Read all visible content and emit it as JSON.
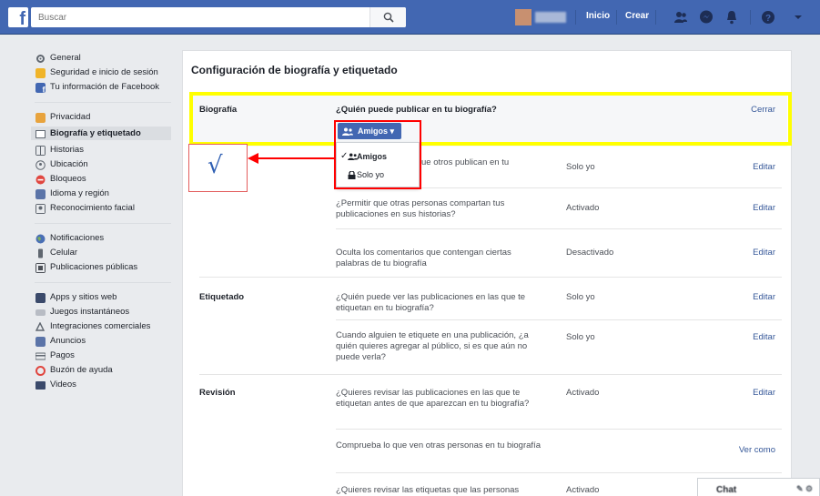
{
  "topbar": {
    "search_placeholder": "Buscar",
    "nav_inicio": "Inicio",
    "nav_crear": "Crear"
  },
  "sidebar": {
    "groups": [
      [
        {
          "label": "General",
          "icon": "gear-icon"
        },
        {
          "label": "Seguridad e inicio de sesión",
          "icon": "shield-icon"
        },
        {
          "label": "Tu información de Facebook",
          "icon": "facebook-icon"
        }
      ],
      [
        {
          "label": "Privacidad",
          "icon": "lock-icon"
        },
        {
          "label": "Biografía y etiquetado",
          "icon": "timeline-icon",
          "active": true
        },
        {
          "label": "Historias",
          "icon": "book-icon"
        },
        {
          "label": "Ubicación",
          "icon": "location-icon"
        },
        {
          "label": "Bloqueos",
          "icon": "block-icon"
        },
        {
          "label": "Idioma y región",
          "icon": "language-icon"
        },
        {
          "label": "Reconocimiento facial",
          "icon": "face-icon"
        }
      ],
      [
        {
          "label": "Notificaciones",
          "icon": "globe-icon"
        },
        {
          "label": "Celular",
          "icon": "phone-icon"
        },
        {
          "label": "Publicaciones públicas",
          "icon": "rss-icon"
        }
      ],
      [
        {
          "label": "Apps y sitios web",
          "icon": "apps-icon"
        },
        {
          "label": "Juegos instantáneos",
          "icon": "game-icon"
        },
        {
          "label": "Integraciones comerciales",
          "icon": "integration-icon"
        },
        {
          "label": "Anuncios",
          "icon": "ads-icon"
        },
        {
          "label": "Pagos",
          "icon": "card-icon"
        },
        {
          "label": "Buzón de ayuda",
          "icon": "help-icon"
        },
        {
          "label": "Videos",
          "icon": "video-icon"
        }
      ]
    ]
  },
  "main": {
    "title": "Configuración de biografía y etiquetado",
    "biografia": {
      "label": "Biografía",
      "expanded_question": "¿Quién puede publicar en tu biografía?",
      "close_label": "Cerrar",
      "privacy_button": "Amigos",
      "dropdown_options": [
        {
          "label": "Amigos",
          "selected": true
        },
        {
          "label": "Solo yo",
          "selected": false
        }
      ],
      "rows": [
        {
          "question": "¿Quién puede ver lo que otros publican en tu biografía?",
          "value": "Solo yo",
          "action": "Editar"
        },
        {
          "question": "¿Permitir que otras personas compartan tus publicaciones en sus historias?",
          "value": "Activado",
          "action": "Editar"
        },
        {
          "question": "Oculta los comentarios que contengan ciertas palabras de tu biografía",
          "value": "Desactivado",
          "action": "Editar"
        }
      ]
    },
    "etiquetado": {
      "label": "Etiquetado",
      "rows": [
        {
          "question": "¿Quién puede ver las publicaciones en las que te etiquetan en tu biografía?",
          "value": "Solo yo",
          "action": "Editar"
        },
        {
          "question": "Cuando alguien te etiquete en una publicación, ¿a quién quieres agregar al público, si es que aún no puede verla?",
          "value": "Solo yo",
          "action": "Editar"
        }
      ]
    },
    "revision": {
      "label": "Revisión",
      "rows": [
        {
          "question": "¿Quieres revisar las publicaciones en las que te etiquetan antes de que aparezcan en tu biografía?",
          "value": "Activado",
          "action": "Editar"
        },
        {
          "question": "Comprueba lo que ven otras personas en tu biografía",
          "value": "",
          "action": "Ver como"
        },
        {
          "question": "¿Quieres revisar las etiquetas que las personas",
          "value": "Activado",
          "action": ""
        }
      ]
    }
  },
  "annotation": {
    "symbol": "√"
  },
  "chat": {
    "label": "Chat"
  },
  "colors": {
    "brand": "#4267b2",
    "link": "#365899",
    "highlight_yellow": "#ffff00",
    "annotation_red": "#ff0000"
  }
}
